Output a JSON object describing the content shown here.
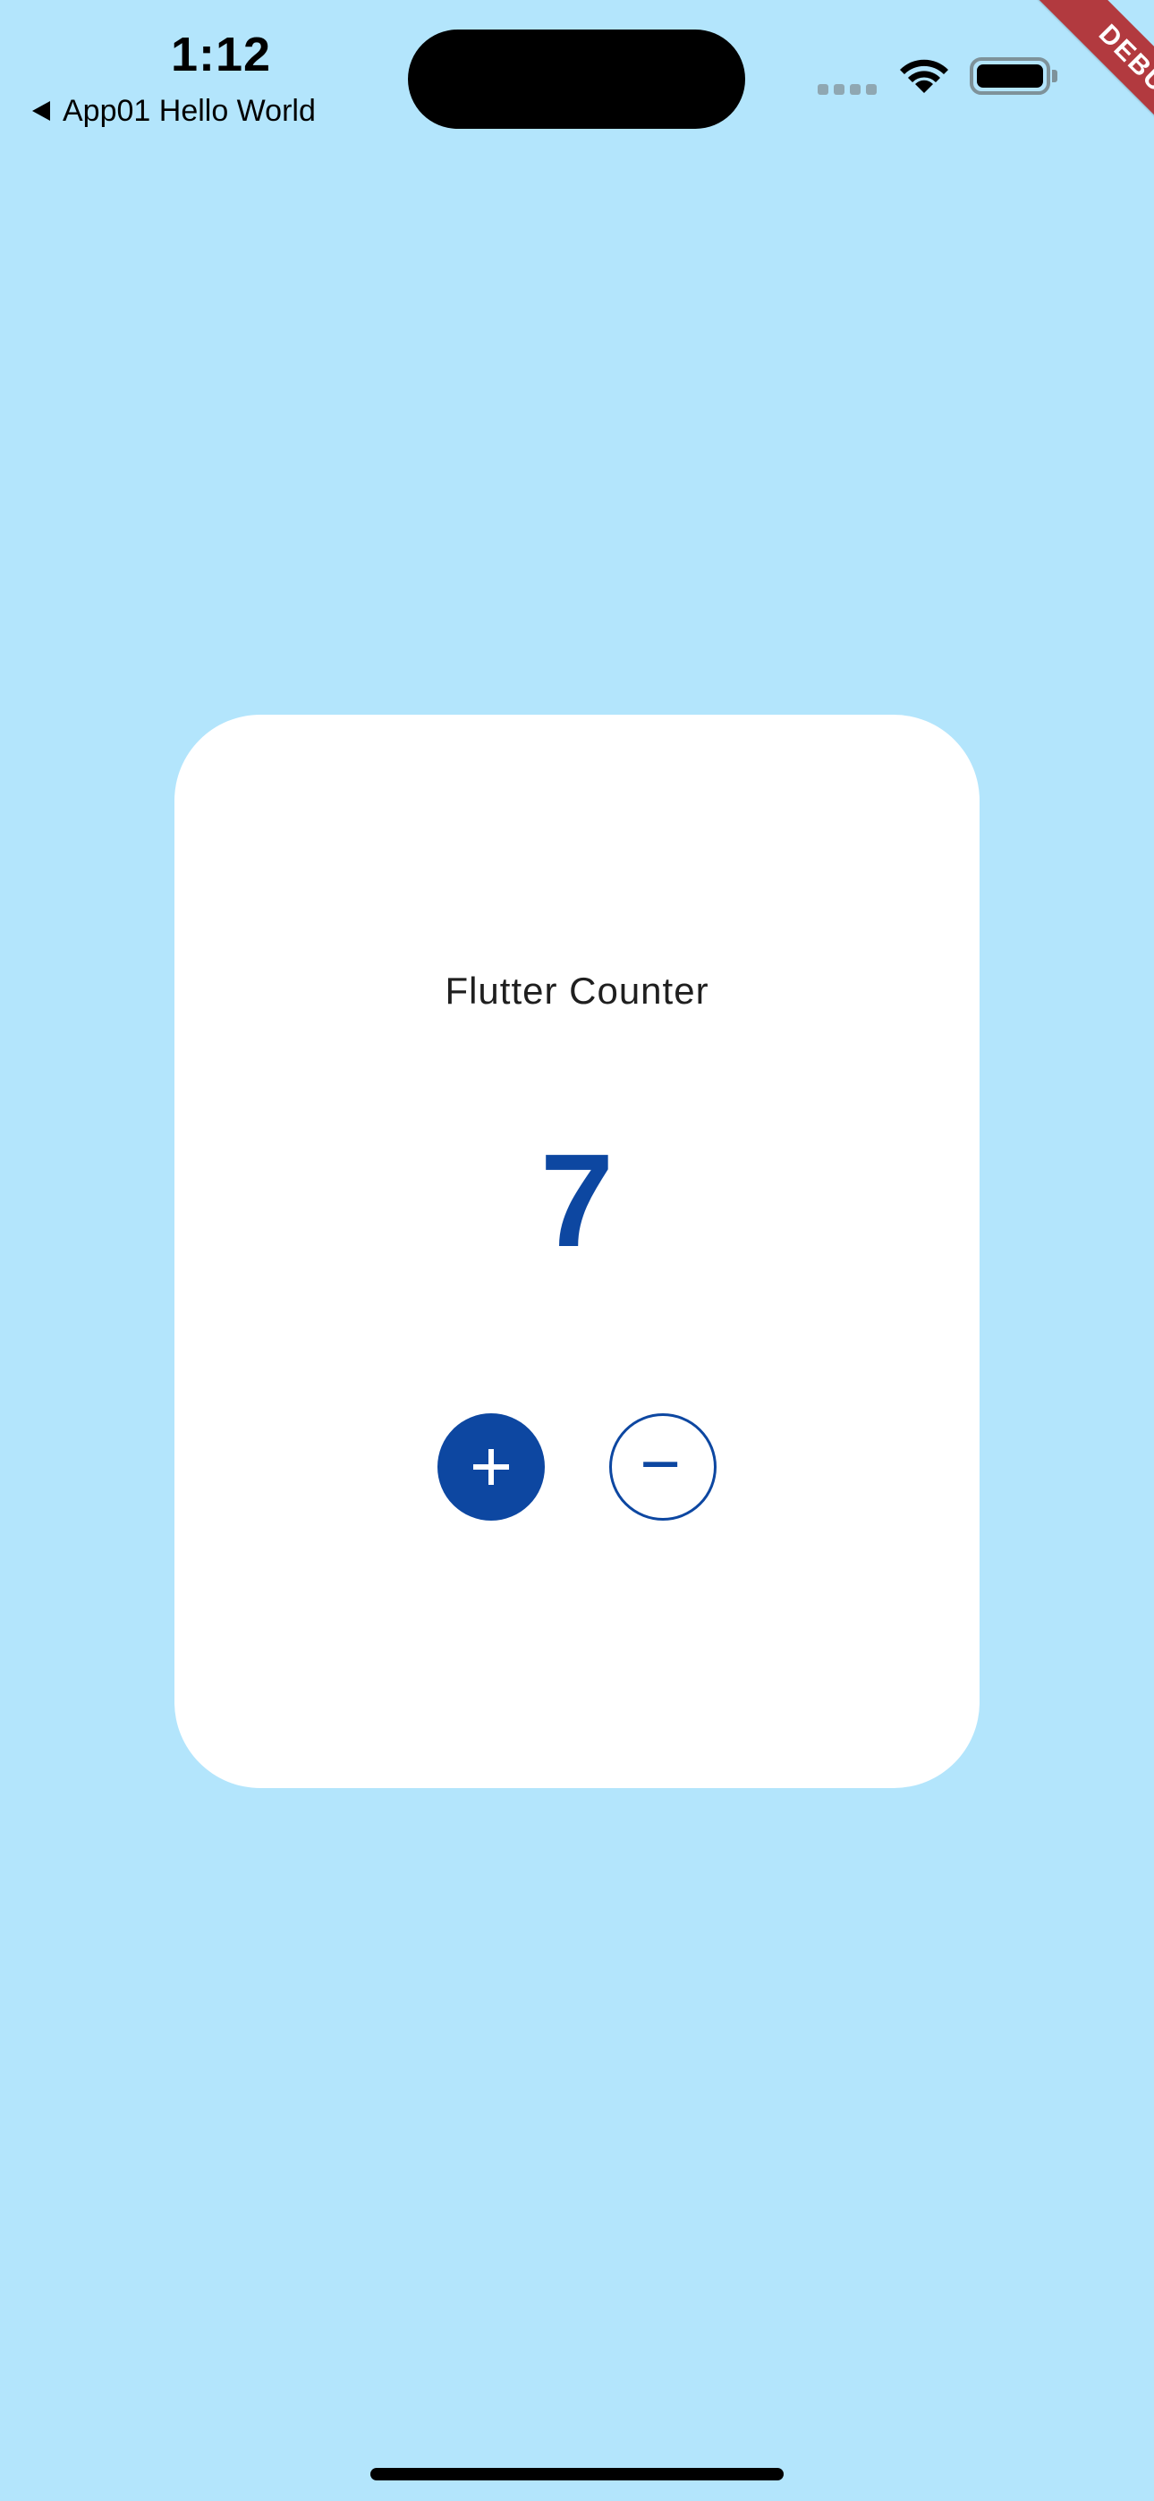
{
  "status_bar": {
    "time": "1:12",
    "back_label": "App01 Hello World"
  },
  "debug_banner": {
    "label": "DEBUG"
  },
  "card": {
    "title": "Flutter Counter",
    "counter_value": "7",
    "increment_icon": "plus-icon",
    "decrement_icon": "minus-icon"
  },
  "colors": {
    "background": "#b3e5fc",
    "card": "#ffffff",
    "accent": "#0d47a1",
    "debug_banner": "#b23a3f"
  }
}
